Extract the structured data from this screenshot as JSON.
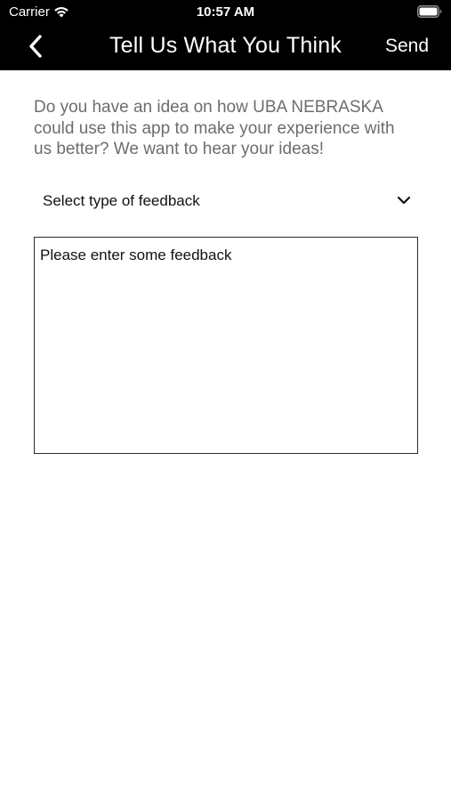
{
  "status_bar": {
    "carrier": "Carrier",
    "time": "10:57 AM",
    "icons": [
      "wifi-icon",
      "battery-icon"
    ]
  },
  "nav": {
    "title": "Tell Us What You Think",
    "send_label": "Send",
    "back_icon": "chevron-left-icon"
  },
  "intro": {
    "text": "Do you have an idea on how UBA NEBRASKA could use this app to make your experience with us better? We want to hear your ideas!"
  },
  "feedback_type": {
    "selected": "Select type of feedback",
    "icon": "chevron-down-icon"
  },
  "feedback_input": {
    "value": "",
    "placeholder": "Please enter some feedback"
  },
  "colors": {
    "header_bg": "#000000",
    "header_text": "#ffffff",
    "intro_text": "#6d6d6d",
    "body_text": "#111111",
    "border": "#2b2b2b"
  }
}
